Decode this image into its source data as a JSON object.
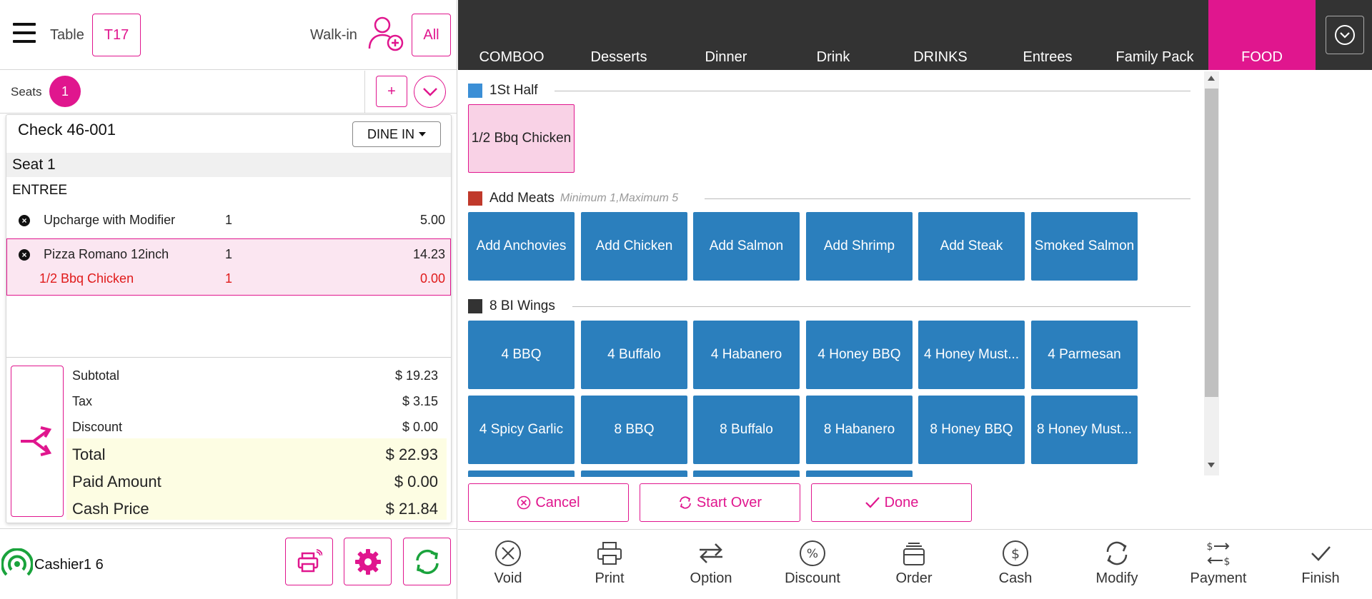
{
  "header": {
    "table_label": "Table",
    "table_value": "T17",
    "walkin_label": "Walk-in",
    "all_label": "All"
  },
  "seats": {
    "label": "Seats",
    "count": "1",
    "add_label": "+"
  },
  "check": {
    "title_prefix": "Check",
    "number": "46-001",
    "dine_mode": "DINE IN",
    "seat_header": "Seat 1",
    "category": "ENTREE",
    "items": [
      {
        "name": "Upcharge with Modifier",
        "qty": "1",
        "amount": "5.00"
      },
      {
        "name": "Pizza Romano 12inch",
        "qty": "1",
        "amount": "14.23"
      },
      {
        "name": "1/2 Bbq Chicken",
        "qty": "1",
        "amount": "0.00"
      }
    ],
    "totals": {
      "subtotal_label": "Subtotal",
      "subtotal": "$ 19.23",
      "tax_label": "Tax",
      "tax": "$ 3.15",
      "discount_label": "Discount",
      "discount": "$ 0.00",
      "total_label": "Total",
      "total": "$ 22.93",
      "paid_label": "Paid Amount",
      "paid": "$ 0.00",
      "cash_label": "Cash Price",
      "cash": "$ 21.84"
    }
  },
  "cashier": {
    "name": "Cashier1 6"
  },
  "categories": [
    "COMBOO",
    "Desserts",
    "Dinner",
    "Drink",
    "DRINKS",
    "Entrees",
    "Family Pack",
    "FOOD"
  ],
  "active_category": "FOOD",
  "menu": {
    "sections": [
      {
        "title": "1St Half",
        "color": "#3b8fd6",
        "hint": "",
        "items": [
          "1/2 Bbq Chicken"
        ]
      },
      {
        "title": "Add Meats",
        "color": "#c0392b",
        "hint": "Minimum 1,Maximum 5",
        "items": [
          "Add Anchovies",
          "Add Chicken",
          "Add Salmon",
          "Add Shrimp",
          "Add Steak",
          "Smoked Salmon"
        ]
      },
      {
        "title": "8 BI Wings",
        "color": "#333333",
        "hint": "",
        "items": [
          "4 BBQ",
          "4 Buffalo",
          "4 Habanero",
          "4 Honey BBQ",
          "4 Honey Must...",
          "4 Parmesan",
          "4 Spicy Garlic",
          "8 BBQ",
          "8 Buffalo",
          "8 Habanero",
          "8 Honey BBQ",
          "8 Honey Must..."
        ]
      }
    ]
  },
  "actions": {
    "cancel": "Cancel",
    "start_over": "Start Over",
    "done": "Done"
  },
  "bottom_bar": [
    "Void",
    "Print",
    "Option",
    "Discount",
    "Order",
    "Cash",
    "Modify",
    "Payment",
    "Finish"
  ],
  "colors": {
    "accent": "#e0168e",
    "tile": "#2b7fbd",
    "nav": "#333333",
    "highlight": "#fdfde3"
  }
}
